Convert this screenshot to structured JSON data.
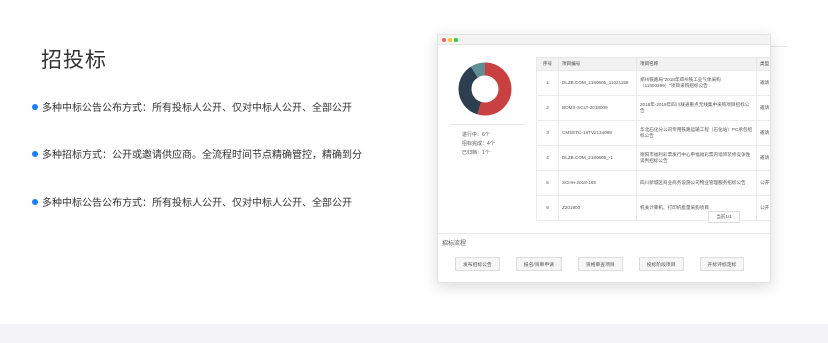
{
  "section": {
    "title": "招投标"
  },
  "features": [
    "多种中标公告公布方式：所有投标人公开、仅对中标人公开、全部公开",
    "多种招标方式：公开或邀请供应商。全流程时间节点精确管控，精确到分",
    "多种中标公告公布方式：所有投标人公开、仅对中标人公开、全部公开"
  ],
  "colors": {
    "accent": "#1a7ff5",
    "donut_red": "#c94040",
    "donut_dark": "#2c3e50",
    "donut_teal": "#5f8f94"
  },
  "summary": {
    "in_progress": "进行中：6个",
    "bid_done": "招标完成：4个",
    "closed": "已归档：1个"
  },
  "donut_data": {
    "segments": [
      {
        "value": 6,
        "color": "#c94040"
      },
      {
        "value": 4,
        "color": "#2c3e50"
      },
      {
        "value": 1,
        "color": "#5f8f94"
      }
    ]
  },
  "table": {
    "headers": [
      "序号",
      "项目编号",
      "项目名称",
      "类型"
    ],
    "rows": [
      [
        "1",
        "DLZB.COM_2180605_11021158",
        "郑州铁路局\"2018年郑州铁工业气体采购（11600399）\"项目采购招标公告",
        "邀请"
      ],
      [
        "2",
        "BOMX-SCLT-2018009",
        "2018年-2019年四川联通重点无线集中采购项目招标公告",
        "邀请"
      ],
      [
        "3",
        "CMSETC-18TV2134099",
        "华北石化分公司专用铁路运输工程（石化站）PC承包招标公告",
        "邀请"
      ],
      [
        "4",
        "DLZB.COM_2180605_-1",
        "德阳市福利彩票发行中心申福福彩票内墙饰装修竞争性谈判招标公告",
        "邀请"
      ],
      [
        "5",
        "SCHH-2018-169",
        "四川新城区商业商务设施公司物业管理服务招标公告",
        "公开"
      ],
      [
        "6",
        "Z201800",
        "机关计算机、打印机批量采购项目",
        "公开"
      ]
    ],
    "pager": "当前1/1"
  },
  "process": {
    "title": "招标流程",
    "steps": [
      "发布招标公告",
      "报名/资审申请",
      "资格审查项目",
      "投标阶段项目",
      "开标评标定标"
    ]
  }
}
